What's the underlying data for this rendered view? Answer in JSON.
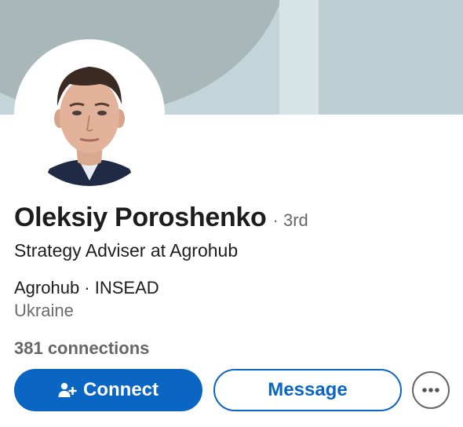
{
  "profile": {
    "name": "Oleksiy Poroshenko",
    "degree": "· 3rd",
    "headline": "Strategy Adviser at Agrohub",
    "org": "Agrohub · INSEAD",
    "location": "Ukraine",
    "connections": "381 connections"
  },
  "actions": {
    "connect_label": "Connect",
    "message_label": "Message",
    "more_icon": "more-horizontal-icon",
    "connect_icon": "add-person-icon"
  },
  "colors": {
    "accent": "#0a66c2",
    "banner": "#c3d5d8"
  }
}
